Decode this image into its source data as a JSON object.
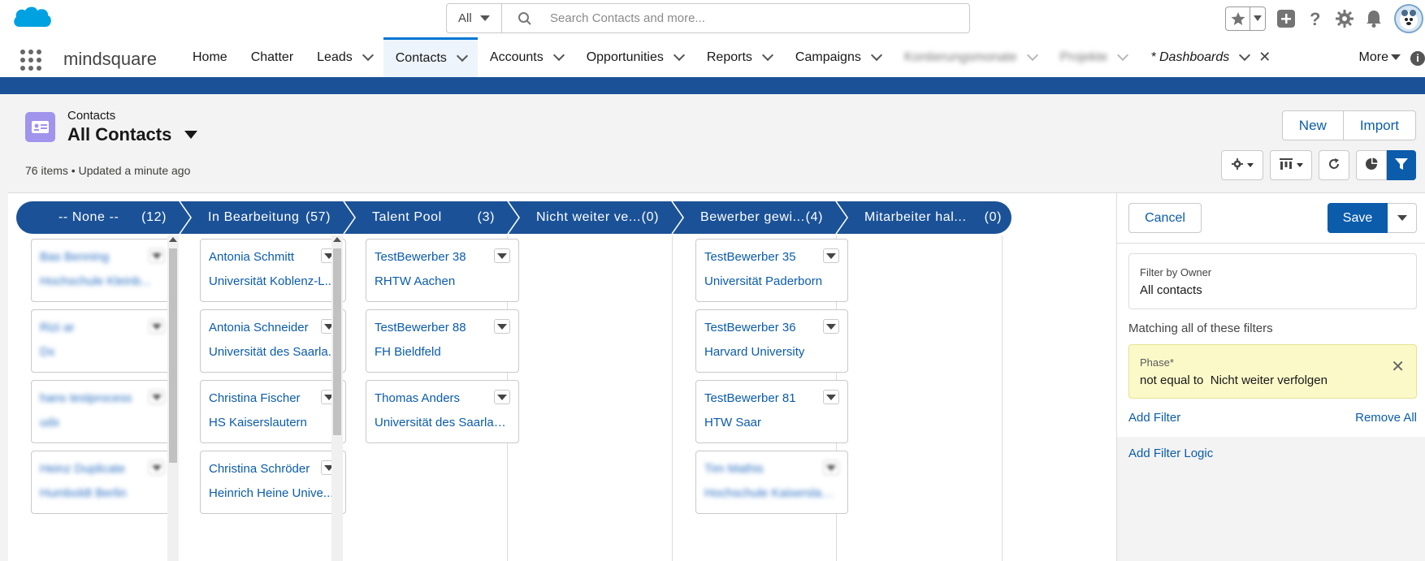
{
  "header": {
    "search_scope": "All",
    "search_placeholder": "Search Contacts and more..."
  },
  "nav": {
    "app_name": "mindsquare",
    "items": [
      {
        "label": "Home"
      },
      {
        "label": "Chatter"
      },
      {
        "label": "Leads"
      },
      {
        "label": "Contacts"
      },
      {
        "label": "Accounts"
      },
      {
        "label": "Opportunities"
      },
      {
        "label": "Reports"
      },
      {
        "label": "Campaigns"
      },
      {
        "label": "Kontierungsmonate"
      },
      {
        "label": "Projekte"
      },
      {
        "label": "* Dashboards"
      }
    ],
    "more_label": "More",
    "info_glyph": "i"
  },
  "list_view": {
    "object_label": "Contacts",
    "title": "All Contacts",
    "meta": "76 items • Updated a minute ago",
    "new_label": "New",
    "import_label": "Import"
  },
  "kanban": {
    "stages": [
      {
        "name": "-- None --",
        "count": "(12)"
      },
      {
        "name": "In Bearbeitung",
        "count": "(57)"
      },
      {
        "name": "Talent Pool",
        "count": "(3)"
      },
      {
        "name": "Nicht weiter ve...",
        "count": "(0)"
      },
      {
        "name": "Bewerber gewi...",
        "count": "(4)"
      },
      {
        "name": "Mitarbeiter hal...",
        "count": "(0)"
      }
    ],
    "col_none": [
      {
        "name": "Bas Benning",
        "sub": "Hochschule Kleinb..."
      },
      {
        "name": "Rizi ar",
        "sub": "Dx"
      },
      {
        "name": "hans testprocess",
        "sub": "udx"
      },
      {
        "name": "Heinz Duplicate",
        "sub": "Humboldt Berlin"
      }
    ],
    "col_bearbeitung": [
      {
        "name": "Antonia Schmitt",
        "sub": "Universität Koblenz-L..."
      },
      {
        "name": "Antonia Schneider",
        "sub": "Universität des Saarla..."
      },
      {
        "name": "Christina Fischer",
        "sub": "HS Kaiserslautern"
      },
      {
        "name": "Christina Schröder",
        "sub": "Heinrich Heine Unive..."
      }
    ],
    "col_talent": [
      {
        "name": "TestBewerber 38",
        "sub": "RHTW Aachen"
      },
      {
        "name": "TestBewerber 88",
        "sub": "FH Bieldfeld"
      },
      {
        "name": "Thomas Anders",
        "sub": "Universität des Saarlan..."
      }
    ],
    "col_bewerber": [
      {
        "name": "TestBewerber 35",
        "sub": "Universität Paderborn"
      },
      {
        "name": "TestBewerber 36",
        "sub": "Harvard University"
      },
      {
        "name": "TestBewerber 81",
        "sub": "HTW Saar"
      },
      {
        "name": "Tim Mathis",
        "sub": "Hochschule Kaiserslaut..."
      }
    ],
    "stage_color": "#1b5297",
    "link_color": "#0b5cab"
  },
  "filter_panel": {
    "cancel_label": "Cancel",
    "save_label": "Save",
    "owner_label": "Filter by Owner",
    "owner_value": "All contacts",
    "matching_label": "Matching all of these filters",
    "filter_field": "Phase*",
    "filter_value": "not equal to  Nicht weiter verfolgen",
    "add_filter": "Add Filter",
    "remove_all": "Remove All",
    "add_logic": "Add Filter Logic",
    "highlight_color": "#fbf9c8"
  }
}
